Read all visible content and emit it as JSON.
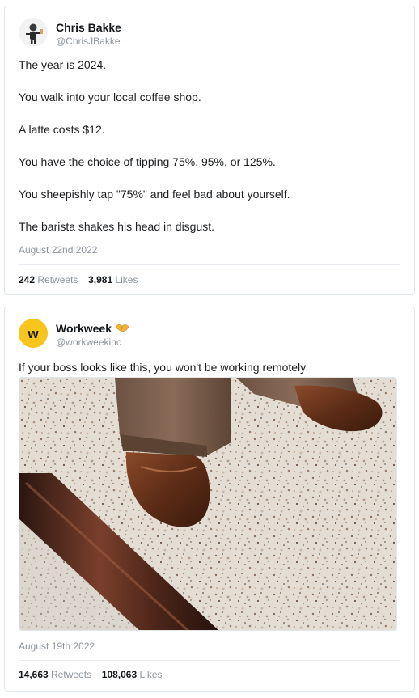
{
  "tweets": [
    {
      "author": {
        "name": "Chris Bakke",
        "handle": "@ChrisJBakke",
        "avatar": "person-avatar-icon"
      },
      "paragraphs": [
        "The year is 2024.",
        "You walk into your local coffee shop.",
        "A latte costs $12.",
        "You have the choice of tipping 75%, 95%, or 125%.",
        "You sheepishly tap \"75%\" and feel bad about yourself.",
        "The barista shakes his head in disgust."
      ],
      "date": "August 22nd 2022",
      "retweets": "242",
      "retweets_label": "Retweets",
      "likes": "3,981",
      "likes_label": "Likes"
    },
    {
      "author": {
        "name": "Workweek",
        "handle": "@workweekinc",
        "avatar": "workweek-logo-icon",
        "avatar_letter": "w",
        "badge": "handshake-emoji-icon"
      },
      "text": "If your boss looks like this, you won't be working remotely",
      "media": "photo-brown-shoes-on-terrazzo-floor",
      "date": "August 19th 2022",
      "retweets": "14,663",
      "retweets_label": "Retweets",
      "likes": "108,063",
      "likes_label": "Likes"
    }
  ],
  "colors": {
    "border": "#e1e8ed",
    "muted": "#8c949c",
    "text": "#14171a",
    "workweek_yellow": "#f7c51e"
  }
}
